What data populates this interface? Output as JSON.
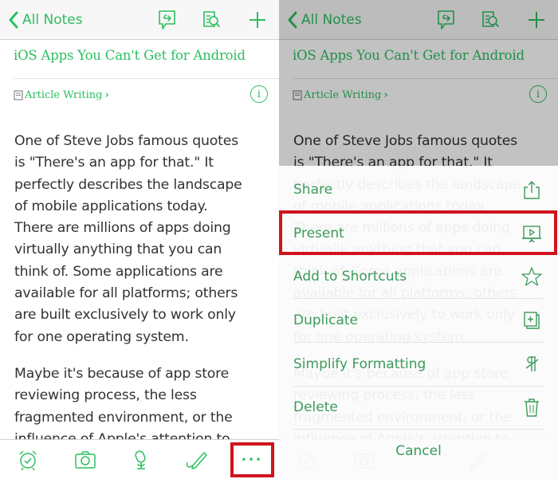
{
  "colors": {
    "accent": "#2dbe60",
    "sheet_text": "#3c9a5a",
    "highlight": "#d0131d",
    "body_text": "#333333"
  },
  "navbar": {
    "back_label": "All Notes",
    "icons": [
      "chevron-left-icon",
      "share-chat-icon",
      "search-note-icon",
      "plus-icon"
    ]
  },
  "note": {
    "title": "iOS Apps You Can't Get for Android",
    "notebook": "Article Writing",
    "notebook_chevron": "›",
    "info_glyph": "i",
    "paragraphs": [
      {
        "lines": [
          "One of Steve Jobs famous quotes",
          "is \"There's an app for that.\" It",
          "perfectly describes the landscape",
          "of mobile applications today.",
          "There are millions of apps doing",
          "virtually anything that you can",
          "think of. Some applications are",
          "available for all platforms; others",
          "are built exclusively to work only",
          "for one operating system."
        ]
      },
      {
        "lines": [
          "Maybe it's because of app store",
          "reviewing process, the less",
          "fragmented environment, or the",
          "influence of Apple's attention to"
        ]
      }
    ]
  },
  "toolbar": {
    "items": [
      {
        "name": "reminder-alarm-icon"
      },
      {
        "name": "camera-icon"
      },
      {
        "name": "audio-microphone-icon"
      },
      {
        "name": "handwriting-pen-icon"
      },
      {
        "name": "more-options-icon",
        "label": "•••"
      }
    ]
  },
  "action_sheet": {
    "items": [
      {
        "label": "Share",
        "icon": "share-upload-icon"
      },
      {
        "label": "Present",
        "icon": "presentation-screen-icon",
        "highlighted": true
      },
      {
        "label": "Add to Shortcuts",
        "icon": "star-icon"
      },
      {
        "label": "Duplicate",
        "icon": "duplicate-icon"
      },
      {
        "label": "Simplify Formatting",
        "icon": "clear-formatting-icon"
      },
      {
        "label": "Delete",
        "icon": "trash-icon"
      }
    ],
    "cancel_label": "Cancel"
  }
}
